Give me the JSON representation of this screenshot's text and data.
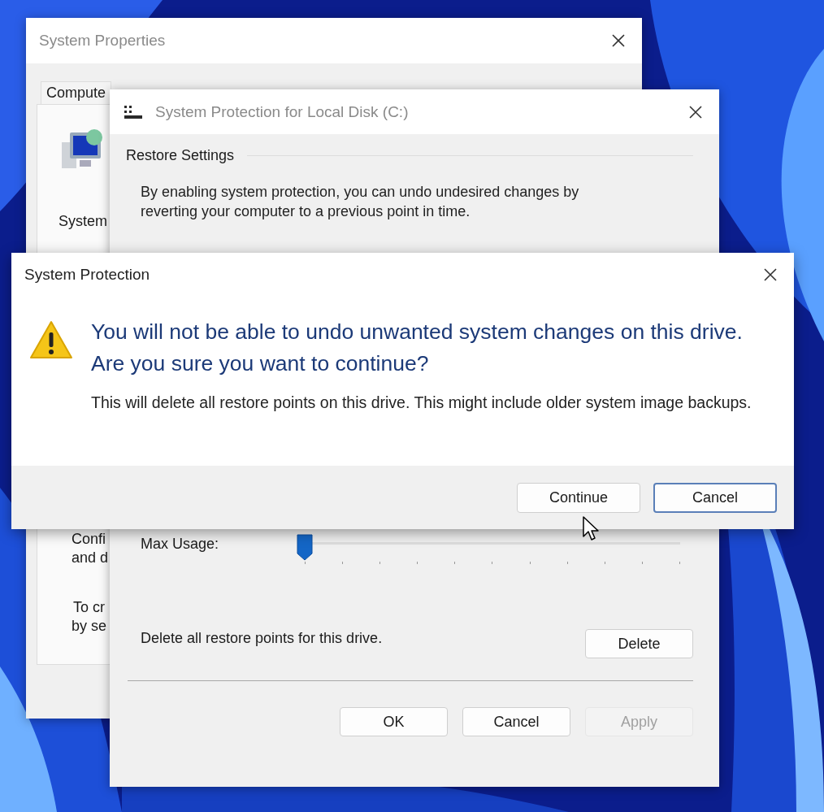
{
  "system_properties": {
    "title": "System Properties",
    "tabs": [
      {
        "label": "Compute",
        "selected": false
      }
    ],
    "panel_texts": [
      "System",
      "Confi",
      "and d",
      "To cr",
      "by se"
    ]
  },
  "protection_window": {
    "title": "System Protection for Local Disk (C:)",
    "section": "Restore Settings",
    "description": "By enabling system protection, you can undo undesired changes by reverting your computer to a previous point in time.",
    "max_usage_label": "Max Usage:",
    "slider": {
      "level": 0
    },
    "delete_text": "Delete all restore points for this drive.",
    "delete_button": "Delete",
    "buttons": [
      {
        "label": "OK",
        "disabled": false
      },
      {
        "label": "Cancel",
        "disabled": false
      },
      {
        "label": "Apply",
        "disabled": true
      }
    ]
  },
  "dialog": {
    "title": "System Protection",
    "heading": "You will not be able to undo unwanted system changes on this drive. Are you sure you want to continue?",
    "message": "This will delete all restore points on this drive. This might include older system image backups.",
    "buttons": [
      {
        "label": "Continue",
        "default": false
      },
      {
        "label": "Cancel",
        "default": true
      }
    ]
  }
}
